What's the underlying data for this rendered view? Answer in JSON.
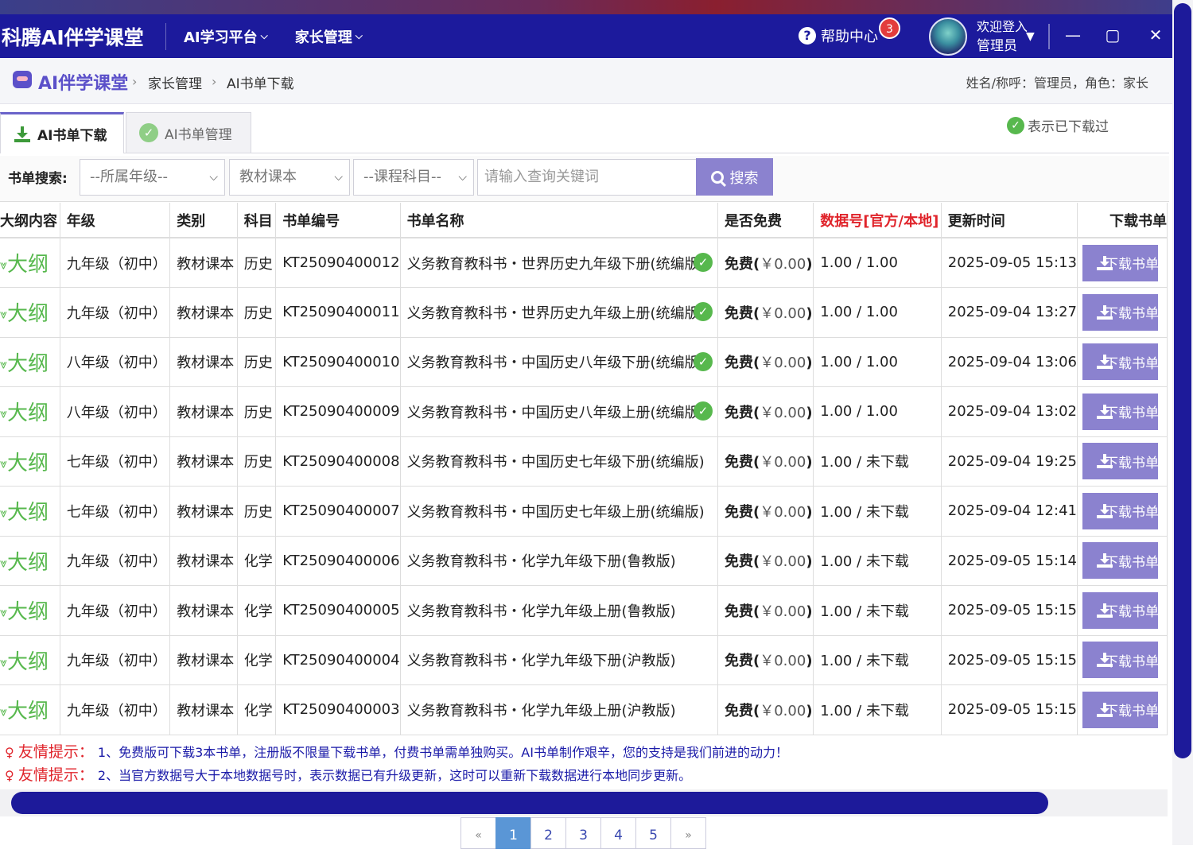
{
  "app": {
    "brand": "科腾AI伴学课堂",
    "nav": [
      {
        "label": "AI学习平台"
      },
      {
        "label": "家长管理"
      }
    ],
    "help_label": "帮助中心",
    "help_badge": "3",
    "welcome": "欢迎登入",
    "username": "管理员",
    "colors": {
      "header": "#1c1a9c",
      "accent": "#8b82cf",
      "success": "#57b84d",
      "warning_text": "#e0242b",
      "tip_text": "#1a1aa8"
    }
  },
  "breadcrumb": {
    "home": "AI伴学课堂",
    "items": [
      "家长管理",
      "AI书单下载"
    ],
    "user_info": "姓名/称呼：管理员，角色：家长"
  },
  "tabs": [
    {
      "label": "AI书单下载",
      "active": true
    },
    {
      "label": "AI书单管理",
      "active": false
    }
  ],
  "legend": "表示已下载过",
  "search": {
    "label": "书单搜索:",
    "grade": "--所属年级--",
    "category": "教材课本",
    "subject": "--课程科目--",
    "placeholder": "请输入查询关键词",
    "button": "搜索"
  },
  "table": {
    "headers": [
      "大纲内容",
      "年级",
      "类别",
      "科目",
      "书单编号",
      "书单名称",
      "是否免费",
      "数据号[官方/本地]",
      "更新时间",
      "下载书单"
    ],
    "outline_label": "大纲",
    "download_label": "下载书单",
    "free_label": "免费(",
    "free_amount": "￥0.00",
    "free_close": ")",
    "rows": [
      {
        "grade": "九年级（初中）",
        "category": "教材课本",
        "subject": "历史",
        "code": "KT25090400012",
        "name": "义务教育教科书・世界历史九年级下册(统编版)",
        "downloaded": true,
        "data": "1.00 / 1.00",
        "updated": "2025-09-05 15:13"
      },
      {
        "grade": "九年级（初中）",
        "category": "教材课本",
        "subject": "历史",
        "code": "KT25090400011",
        "name": "义务教育教科书・世界历史九年级上册(统编版)",
        "downloaded": true,
        "data": "1.00 / 1.00",
        "updated": "2025-09-04 13:27"
      },
      {
        "grade": "八年级（初中）",
        "category": "教材课本",
        "subject": "历史",
        "code": "KT25090400010",
        "name": "义务教育教科书・中国历史八年级下册(统编版)",
        "downloaded": true,
        "data": "1.00 / 1.00",
        "updated": "2025-09-04 13:06"
      },
      {
        "grade": "八年级（初中）",
        "category": "教材课本",
        "subject": "历史",
        "code": "KT25090400009",
        "name": "义务教育教科书・中国历史八年级上册(统编版)",
        "downloaded": true,
        "data": "1.00 / 1.00",
        "updated": "2025-09-04 13:02"
      },
      {
        "grade": "七年级（初中）",
        "category": "教材课本",
        "subject": "历史",
        "code": "KT25090400008",
        "name": "义务教育教科书・中国历史七年级下册(统编版)",
        "downloaded": false,
        "data": "1.00 / 未下载",
        "updated": "2025-09-04 19:25"
      },
      {
        "grade": "七年级（初中）",
        "category": "教材课本",
        "subject": "历史",
        "code": "KT25090400007",
        "name": "义务教育教科书・中国历史七年级上册(统编版)",
        "downloaded": false,
        "data": "1.00 / 未下载",
        "updated": "2025-09-04 12:41"
      },
      {
        "grade": "九年级（初中）",
        "category": "教材课本",
        "subject": "化学",
        "code": "KT25090400006",
        "name": "义务教育教科书・化学九年级下册(鲁教版)",
        "downloaded": false,
        "data": "1.00 / 未下载",
        "updated": "2025-09-05 15:14"
      },
      {
        "grade": "九年级（初中）",
        "category": "教材课本",
        "subject": "化学",
        "code": "KT25090400005",
        "name": "义务教育教科书・化学九年级上册(鲁教版)",
        "downloaded": false,
        "data": "1.00 / 未下载",
        "updated": "2025-09-05 15:15"
      },
      {
        "grade": "九年级（初中）",
        "category": "教材课本",
        "subject": "化学",
        "code": "KT25090400004",
        "name": "义务教育教科书・化学九年级下册(沪教版)",
        "downloaded": false,
        "data": "1.00 / 未下载",
        "updated": "2025-09-05 15:15"
      },
      {
        "grade": "九年级（初中）",
        "category": "教材课本",
        "subject": "化学",
        "code": "KT25090400003",
        "name": "义务教育教科书・化学九年级上册(沪教版)",
        "downloaded": false,
        "data": "1.00 / 未下载",
        "updated": "2025-09-05 15:15"
      }
    ]
  },
  "tips": [
    {
      "label": "友情提示：",
      "text": "1、免费版可下载3本书单，注册版不限量下载书单，付费书单需单独购买。AI书单制作艰辛，您的支持是我们前进的动力！"
    },
    {
      "label": "友情提示：",
      "text": "2、当官方数据号大于本地数据号时，表示数据已有升级更新，这时可以重新下载数据进行本地同步更新。"
    }
  ],
  "pagination": {
    "prev": "«",
    "pages": [
      "1",
      "2",
      "3",
      "4",
      "5"
    ],
    "current": "1",
    "next": "»"
  }
}
